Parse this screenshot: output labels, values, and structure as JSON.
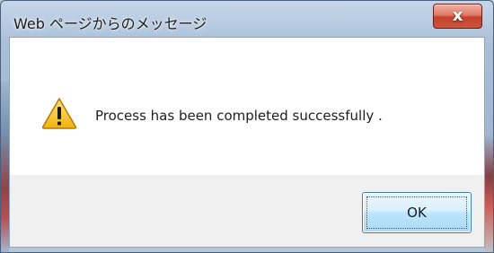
{
  "dialog": {
    "title": "Web ページからのメッセージ",
    "message": "Process has been completed successfully .",
    "ok_label": "OK",
    "icon": "warning-icon"
  },
  "titlebar": {
    "close_glyph": "x",
    "close_icon": "close-icon"
  },
  "colors": {
    "close_button": "#c6422c",
    "dialog_body": "#ffffff",
    "footer": "#f0f0f0",
    "ok_button_border": "#3c7fb1",
    "warning_fill": "#f6c21b"
  }
}
